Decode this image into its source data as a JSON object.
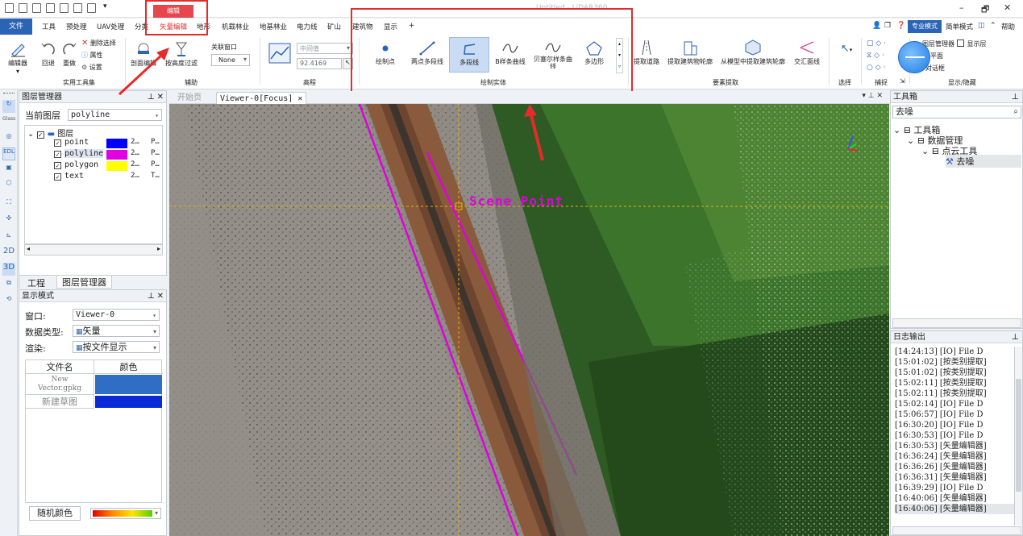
{
  "window": {
    "title": "Untitled - LiDAR360",
    "min": "–",
    "max": "🗗",
    "close": "✕"
  },
  "menu": {
    "file": "文件",
    "items": [
      "工具",
      "预处理",
      "UAV处理",
      "分类",
      "矢量编辑",
      "地形",
      "机载林业",
      "地基林业",
      "电力线",
      "矿山",
      "建筑物",
      "显示",
      "+"
    ],
    "edit_context": "编辑",
    "right": {
      "mode_pro": "专业模式",
      "mode_simple": "简单模式",
      "help": "帮助"
    }
  },
  "ribbon": {
    "editor": "编辑器",
    "undo": "回退",
    "redo": "重做",
    "delete_sel": "删除选择",
    "attr": "属性",
    "settings": "设置",
    "grp_tools": "实用工具集",
    "profile_edit": "剖面编辑",
    "height_filter": "按高度过滤",
    "link_window": "关联窗口",
    "link_value": "None",
    "grp_aux": "辅助",
    "elev_mode": "中间值",
    "elev_value": "92.4169",
    "grp_elev": "高程",
    "draw_point": "绘制点",
    "two_point_polyline": "两点多段线",
    "polyline": "多段线",
    "bspline": "B样条曲线",
    "bezier": "贝塞尔样条曲线",
    "polygon": "多边形",
    "grp_draw": "绘制实体",
    "extract_road": "提取道路",
    "extract_building": "提取建筑物轮廓",
    "extract_from_model": "从模型中提取建筑轮廓",
    "intersect": "交汇面线",
    "grp_extract": "要素提取",
    "select": "选择",
    "grp_select": "选择",
    "grp_snap": "捕捉",
    "layer_mgr": "图层管理器",
    "show_layer": "显示层",
    "plane": "平面",
    "dialog": "对话框",
    "grp_show": "显示/隐藏"
  },
  "left_strip": [
    "Glass",
    "EDL",
    "2D",
    "3D"
  ],
  "layer_panel": {
    "title": "图层管理器",
    "current_label": "当前图层",
    "current_value": "polyline",
    "root": "图层",
    "layers": [
      {
        "name": "point",
        "count": "2…",
        "type": "P…",
        "color": "#0000ff"
      },
      {
        "name": "polyline",
        "count": "2…",
        "type": "P…",
        "color": "#e000e0"
      },
      {
        "name": "polygon",
        "count": "2…",
        "type": "P…",
        "color": "#ffff00"
      },
      {
        "name": "text",
        "count": "2…",
        "type": "T…",
        "color": ""
      }
    ],
    "tab_project": "工程",
    "tab_layers": "图层管理器"
  },
  "display_panel": {
    "title": "显示模式",
    "window_label": "窗口:",
    "window_value": "Viewer-0",
    "dtype_label": "数据类型:",
    "dtype_value": "矢量",
    "render_label": "渲染:",
    "render_value": "按文件显示",
    "col_file": "文件名",
    "col_color": "颜色",
    "files": [
      {
        "name": "New Vector.gpkg",
        "color": "#2f6ec4"
      },
      {
        "name": "新建草图",
        "color": "#0a2ad8"
      }
    ],
    "random_color": "随机颜色"
  },
  "viewer": {
    "tab_start": "开始页",
    "tab_viewer": "Viewer-0[Focus]",
    "scene_label": "Scene Point"
  },
  "toolbox": {
    "title": "工具箱",
    "search": "去噪",
    "root": "工具箱",
    "data_mgmt": "数据管理",
    "pc_tools": "点云工具",
    "denoise": "去噪"
  },
  "log": {
    "title": "日志输出",
    "lines": [
      "[14:24:13] [IO]      File D",
      "[15:01:02] [按类别提取]",
      "[15:01:02] [按类别提取]",
      "[15:02:11] [按类别提取]",
      "[15:02:11] [按类别提取]",
      "[15:02:14] [IO]      File D",
      "[15:06:57] [IO]      File D",
      "[16:30:20] [IO]      File D",
      "[16:30:53] [IO]      File D",
      "[16:30:53] [矢量编辑器]",
      "[16:36:24] [矢量编辑器]",
      "[16:36:26] [矢量编辑器]",
      "[16:36:31] [矢量编辑器]",
      "[16:39:29] [IO]      File D",
      "[16:40:06] [矢量编辑器]",
      "[16:40:06] [矢量编辑器]"
    ]
  },
  "colors": {
    "accent": "#2b63b5",
    "highlight": "#e52b2b",
    "polyline": "#e000e0"
  }
}
